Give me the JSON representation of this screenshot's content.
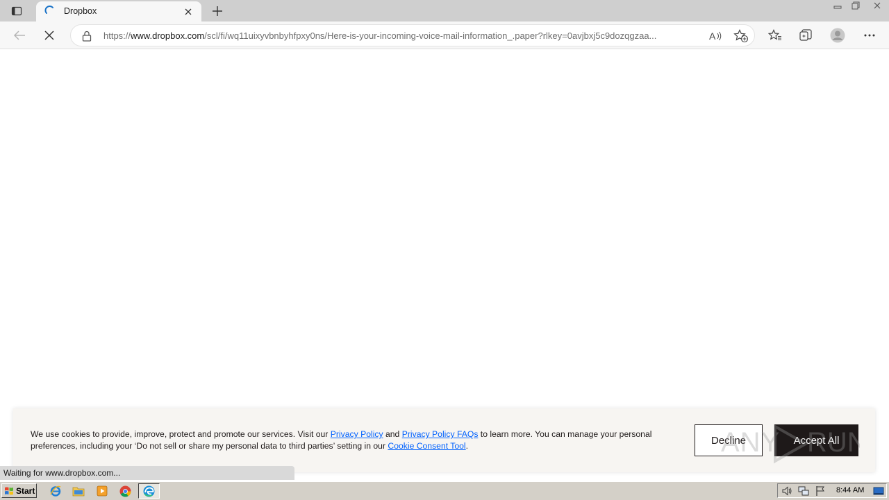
{
  "browser": {
    "tab": {
      "title": "Dropbox",
      "state": "loading"
    },
    "address": {
      "scheme": "https://",
      "host": "www.dropbox.com",
      "path": "/scl/fi/wq11uixyvbnbyhfpxy0ns/Here-is-your-incoming-voice-mail-information_.paper?rlkey=0avjbxj5c9dozqgzaa..."
    },
    "status_text": "Waiting for www.dropbox.com..."
  },
  "cookie_banner": {
    "text_1": "We use cookies to provide, improve, protect and promote our services. Visit our ",
    "link_privacy": "Privacy Policy",
    "text_2": " and ",
    "link_faqs": "Privacy Policy FAQs",
    "text_3": " to learn more. You can manage your personal preferences, including your ‘Do not sell or share my personal data to third parties’ setting in our ",
    "link_consent": "Cookie Consent Tool",
    "text_4": ".",
    "decline_label": "Decline",
    "accept_label": "Accept All",
    "link_color": "#0061fe",
    "accept_bg": "#1e1919"
  },
  "taskbar": {
    "start_label": "Start",
    "quick_launch": [
      "internet-explorer-icon",
      "file-explorer-icon",
      "media-player-icon",
      "chrome-icon"
    ],
    "active_app": "edge-icon",
    "tray_icons": [
      "volume-icon",
      "network-icon",
      "flag-icon"
    ],
    "clock": "8:44 AM"
  },
  "watermark": "ANY.RUN"
}
